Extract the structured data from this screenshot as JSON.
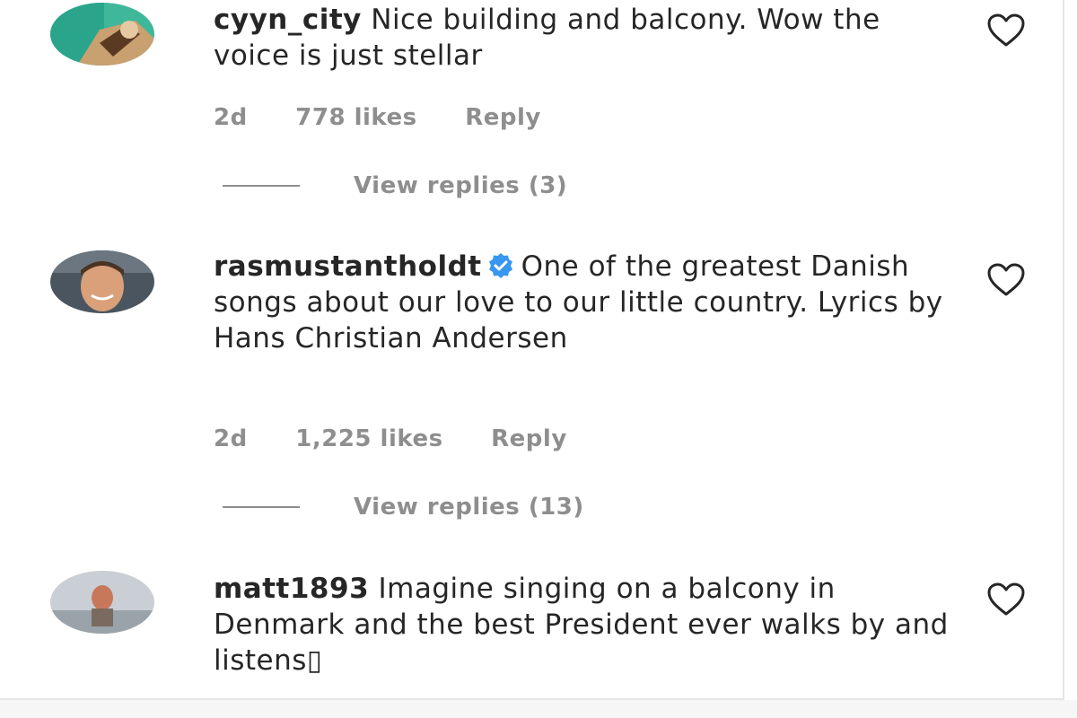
{
  "comments": [
    {
      "username": "cyyn_city",
      "text": "Nice building and balcony. Wow the voice is just stellar",
      "age": "2d",
      "likes": "778 likes",
      "reply_label": "Reply",
      "view_replies": "View replies (3)",
      "verified": false
    },
    {
      "username": "rasmustantholdt",
      "text": "One of the greatest Danish songs about our love to our little country. Lyrics by Hans Christian Andersen",
      "age": "2d",
      "likes": "1,225 likes",
      "reply_label": "Reply",
      "view_replies": "View replies (13)",
      "verified": true
    },
    {
      "username": "matt1893",
      "text": "Imagine singing on a balcony in Denmark and the best President ever walks by and listens▯",
      "verified": false
    }
  ],
  "colors": {
    "text": "#262626",
    "secondary": "#8e8e8e",
    "verified": "#3897f0",
    "divider": "#e6e6e6"
  },
  "icons": {
    "like": "heart-outline-icon",
    "verified": "verified-badge-icon"
  }
}
